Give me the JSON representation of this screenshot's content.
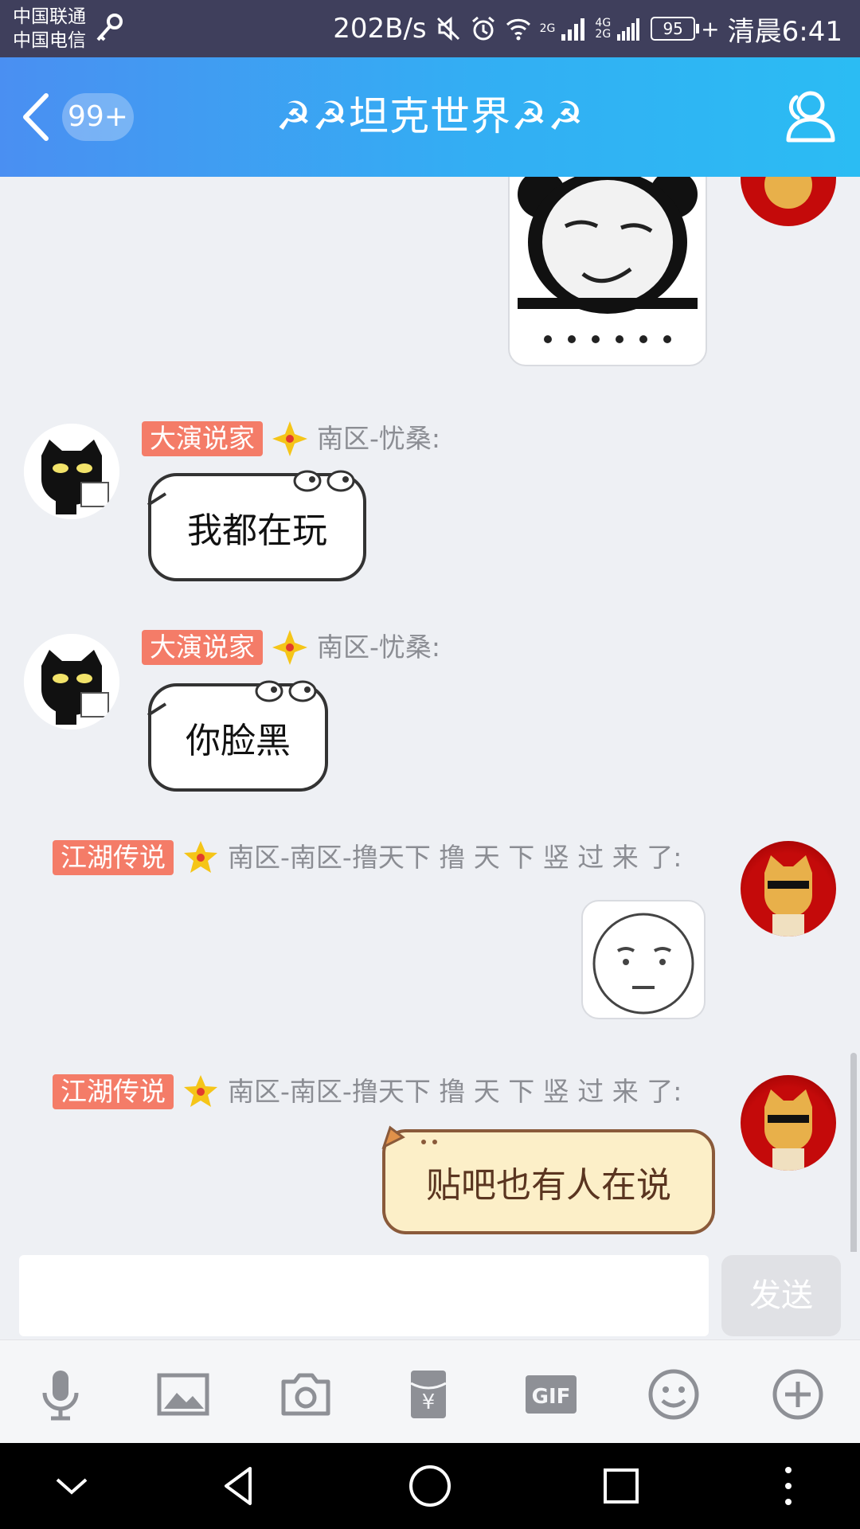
{
  "status_bar": {
    "carrier_1": "中国联通",
    "carrier_2": "中国电信",
    "net_speed": "202B/s",
    "net_2g": "2G",
    "net_4g": "4G",
    "net_2g_b": "2G",
    "battery": "95",
    "time": "清晨6:41"
  },
  "header": {
    "unread_count": "99+",
    "title": "☭☭坦克世界☭☭",
    "colors": {
      "gradient_start": "#4a8ff2",
      "gradient_end": "#2bbcf3"
    }
  },
  "messages": [
    {
      "side": "right",
      "type": "sticker",
      "sticker": "panda-meme",
      "caption": "......"
    },
    {
      "side": "left",
      "rank": "大演说家",
      "sender": "南区-忧桑:",
      "text": "我都在玩"
    },
    {
      "side": "left",
      "rank": "大演说家",
      "sender": "南区-忧桑:",
      "text": "你脸黑"
    },
    {
      "side": "right",
      "rank": "江湖传说",
      "sender": "南区-南区-撸天下 撸 天 下 竖 过 来 了:",
      "type": "sticker",
      "sticker": "doubtful-face"
    },
    {
      "side": "right",
      "rank": "江湖传说",
      "sender": "南区-南区-撸天下 撸 天 下 竖 过 来 了:",
      "text": "贴吧也有人在说"
    }
  ],
  "input": {
    "placeholder": "",
    "send_label": "发送"
  },
  "toolbar": {
    "items": [
      "mic-icon",
      "image-icon",
      "camera-icon",
      "red-packet-icon",
      "gif-icon",
      "emoji-icon",
      "plus-icon"
    ],
    "gif_label": "GIF",
    "yen_label": "¥"
  },
  "colors": {
    "rank_badge": "#f47c68",
    "send_disabled": "#e0e1e5",
    "chat_bg": "#eef0f4"
  }
}
